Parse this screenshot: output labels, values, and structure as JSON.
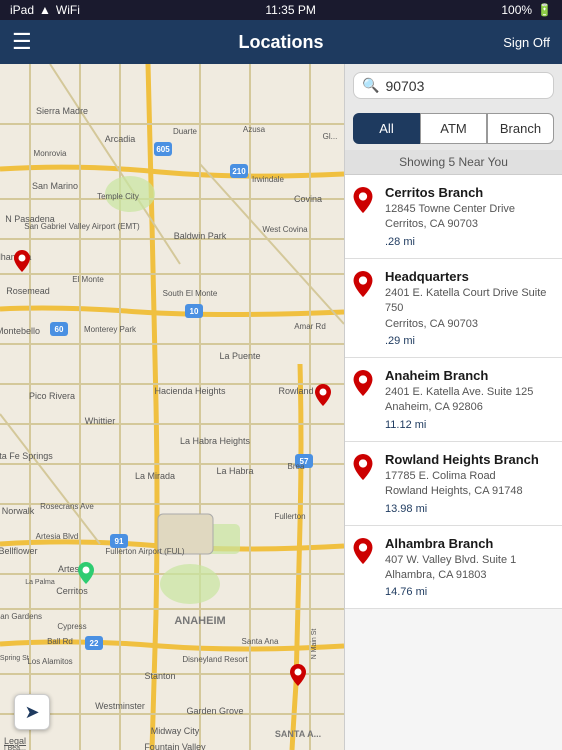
{
  "statusBar": {
    "carrier": "iPad",
    "time": "11:35 PM",
    "signal": "▲",
    "wifi": "WiFi",
    "batteryPercent": "100%"
  },
  "navBar": {
    "title": "Locations",
    "signOff": "Sign Off",
    "menuIcon": "☰"
  },
  "search": {
    "placeholder": "90703",
    "searchIconLabel": "🔍"
  },
  "filters": [
    {
      "id": "all",
      "label": "All",
      "active": true
    },
    {
      "id": "atm",
      "label": "ATM",
      "active": false
    },
    {
      "id": "branch",
      "label": "Branch",
      "active": false
    }
  ],
  "showingText": "Showing 5 Near You",
  "locations": [
    {
      "name": "Cerritos Branch",
      "address": "12845 Towne Center Drive\nCerritos, CA 90703",
      "distance": ".28 mi"
    },
    {
      "name": "Headquarters",
      "address": "2401 E. Katella Court Drive Suite 750\nCerritos, CA 90703",
      "distance": ".29 mi"
    },
    {
      "name": "Anaheim Branch",
      "address": "2401 E. Katella Ave. Suite 125\nAnaheim, CA 92806",
      "distance": "11.12 mi"
    },
    {
      "name": "Rowland Heights Branch",
      "address": "17785 E. Colima Road\nRowland Heights, CA 91748",
      "distance": "13.98 mi"
    },
    {
      "name": "Alhambra Branch",
      "address": "407 W. Valley Blvd. Suite 1\nAlhambra, CA 91803",
      "distance": "14.76 mi"
    }
  ],
  "locationBtn": "⊕",
  "legalText": "Legal"
}
